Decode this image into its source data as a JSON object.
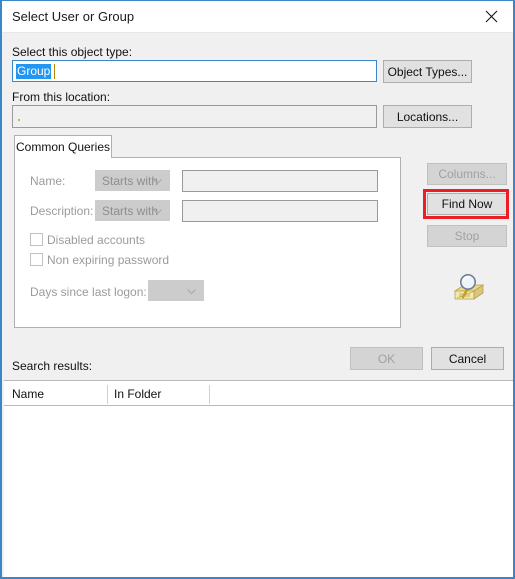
{
  "window": {
    "title": "Select User or Group",
    "close_icon": "close-icon",
    "accent_color": "#3a86c8",
    "highlight_color": "#ee1c25"
  },
  "object_type": {
    "label": "Select this object type:",
    "value": "Group",
    "button": "Object Types..."
  },
  "location": {
    "label": "From this location:",
    "value": "",
    "button": "Locations..."
  },
  "tab": {
    "label": "Common Queries"
  },
  "queries": {
    "name": {
      "label": "Name:",
      "operator": "Starts with",
      "value": ""
    },
    "description": {
      "label": "Description:",
      "operator": "Starts with",
      "value": ""
    },
    "disabled_accounts": {
      "label": "Disabled accounts",
      "checked": false
    },
    "non_expiring_password": {
      "label": "Non expiring password",
      "checked": false
    },
    "days_since_last_logon": {
      "label": "Days since last logon:",
      "value": ""
    }
  },
  "side_buttons": {
    "columns": "Columns...",
    "find_now": "Find Now",
    "stop": "Stop",
    "search_icon": "magnifier-search-icon"
  },
  "footer": {
    "ok": "OK",
    "cancel": "Cancel"
  },
  "results": {
    "label": "Search results:",
    "columns": [
      "Name",
      "In Folder"
    ],
    "rows": []
  }
}
